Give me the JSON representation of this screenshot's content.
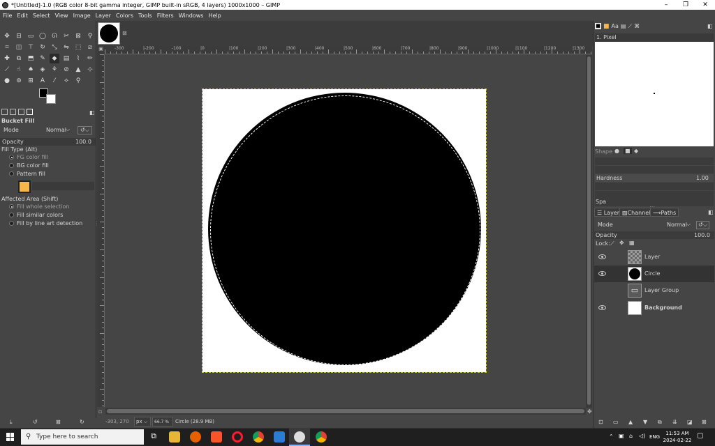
{
  "window": {
    "title": "*[Untitled]-1.0 (RGB color 8-bit gamma integer, GIMP built-in sRGB, 4 layers) 1000x1000 – GIMP",
    "minimize": "–",
    "restore": "❐",
    "close": "✕"
  },
  "menu": [
    "File",
    "Edit",
    "Select",
    "View",
    "Image",
    "Layer",
    "Colors",
    "Tools",
    "Filters",
    "Windows",
    "Help"
  ],
  "tab": {
    "close": "⊠"
  },
  "tool_options": {
    "title": "Bucket Fill",
    "mode_label": "Mode",
    "mode_value": "Normal",
    "opacity_label": "Opacity",
    "opacity_value": "100.0",
    "fill_type_label": "Fill Type  (Alt)",
    "fill_types": [
      "FG color fill",
      "BG color fill",
      "Pattern fill"
    ],
    "affected_area_label": "Affected Area  (Shift)",
    "affected_areas": [
      "Fill whole selection",
      "Fill similar colors",
      "Fill by line art detection"
    ]
  },
  "ruler": {
    "labels": [
      "-300",
      "|-200",
      "-100",
      "|0",
      "|100",
      "|200",
      "|300",
      "|400",
      "|500",
      "|600",
      "|700",
      "|800",
      "|900",
      "|1000",
      "|1100",
      "|1200",
      "|1300"
    ]
  },
  "status": {
    "coords": "-303, 270",
    "unit": "px",
    "zoom": "66.7 %",
    "layer_info": "Circle (28.9 MB)"
  },
  "brushes": {
    "name": "1. Pixel",
    "shape_label": "Shape",
    "hardness_label": "Hardness",
    "hardness_value": "1.00",
    "spacing_label": "Spa"
  },
  "layers_panel": {
    "tabs": [
      "Layers",
      "Channels",
      "Paths"
    ],
    "mode_label": "Mode",
    "mode_value": "Normal",
    "opacity_label": "Opacity",
    "opacity_value": "100.0",
    "lock_label": "Lock:",
    "layers": [
      {
        "name": "Layer",
        "visible": true
      },
      {
        "name": "Circle",
        "visible": true
      },
      {
        "name": "Layer Group",
        "visible": false
      },
      {
        "name": "Background",
        "visible": true
      }
    ]
  },
  "taskbar": {
    "search_placeholder": "Type here to search",
    "lang": "ENG",
    "time": "11:53 AM",
    "date": "2024-02-22"
  },
  "colors": {
    "accent_pattern": "#f6b74a",
    "fg": "#000000",
    "bg": "#ffffff"
  }
}
